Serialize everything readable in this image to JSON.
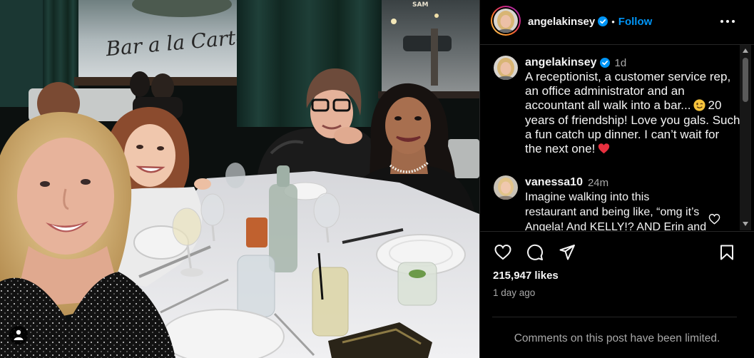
{
  "app": {
    "background": "#000000",
    "text": "#f5f5f5",
    "secondary_text": "#a8a8a8",
    "border": "#262626",
    "accent": "#0095f6"
  },
  "photo": {
    "sign_text": "Bar a la Carte",
    "storefront_text": "SAM",
    "tagged_icon": "tagged-users-icon"
  },
  "header": {
    "avatar_icon": "profile-avatar-story-ring",
    "username": "angelakinsey",
    "verified_icon": "verified-badge-icon",
    "separator": "•",
    "follow_label": "Follow",
    "more_icon": "more-options-icon"
  },
  "caption": {
    "username": "angelakinsey",
    "verified_icon": "verified-badge-icon",
    "time": "1d",
    "lines": [
      "A receptionist, a customer service rep,",
      "an office administrator and an",
      "accountant all walk into a bar...",
      "years of friendship! Love you gals. Such",
      "a fun catch up dinner. I can’t wait for",
      "the next one!"
    ],
    "line3_after_emoji": "20",
    "wink_emoji": "winking-face-emoji",
    "heart_emoji": "red-heart-emoji"
  },
  "comments": [
    {
      "username": "vanessa10",
      "time": "24m",
      "lines": [
        "Imagine walking into this",
        "restaurant and being like, “omg it’s",
        "Angela! And KELLY!? AND Erin and"
      ],
      "like_icon": "heart-outline-icon"
    }
  ],
  "actions": {
    "like_icon": "heart-outline-icon",
    "comment_icon": "comment-bubble-icon",
    "share_icon": "paper-plane-icon",
    "save_icon": "bookmark-icon"
  },
  "likes": "215,947 likes",
  "date": "1 day ago",
  "comments_limited": "Comments on this post have been limited."
}
